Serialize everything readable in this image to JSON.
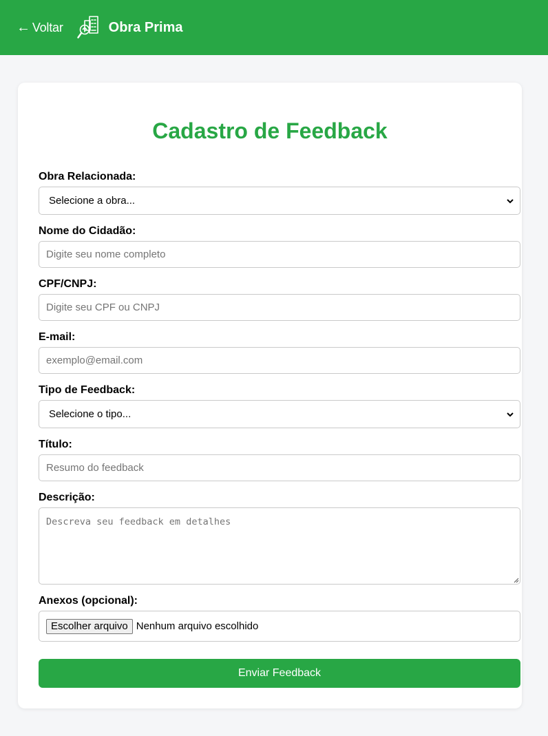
{
  "header": {
    "back_label": "Voltar",
    "back_arrow": "←",
    "brand_name": "Obra Prima",
    "brand_icon": "buildings-magnifier-icon",
    "background_color": "#28a745"
  },
  "form": {
    "title": "Cadastro de Feedback",
    "title_color": "#28a745",
    "fields": {
      "obra": {
        "label": "Obra Relacionada:",
        "selected": "Selecione a obra..."
      },
      "nome": {
        "label": "Nome do Cidadão:",
        "placeholder": "Digite seu nome completo"
      },
      "cpf": {
        "label": "CPF/CNPJ:",
        "placeholder": "Digite seu CPF ou CNPJ"
      },
      "email": {
        "label": "E-mail:",
        "placeholder": "exemplo@email.com"
      },
      "tipo": {
        "label": "Tipo de Feedback:",
        "selected": "Selecione o tipo..."
      },
      "titulo": {
        "label": "Título:",
        "placeholder": "Resumo do feedback"
      },
      "descricao": {
        "label": "Descrição:",
        "placeholder": "Descreva seu feedback em detalhes"
      },
      "anexos": {
        "label": "Anexos (opcional):",
        "button_label": "Escolher arquivo",
        "status": "Nenhum arquivo escolhido"
      }
    },
    "submit_label": "Enviar Feedback",
    "submit_color": "#28a745"
  }
}
